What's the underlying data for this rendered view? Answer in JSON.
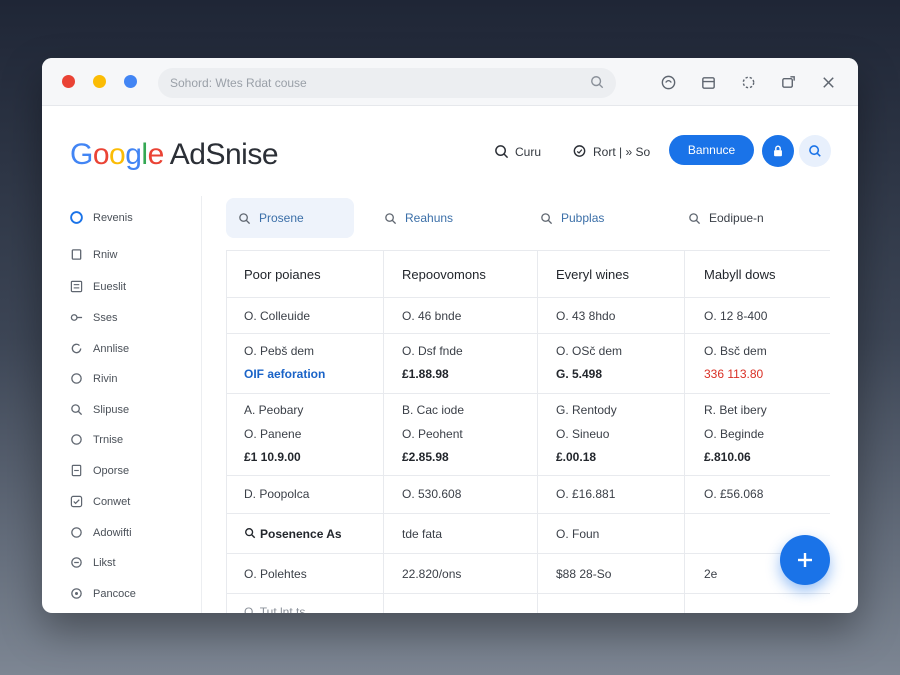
{
  "browser": {
    "url_text": "Sohord: Wtes Rdat couse"
  },
  "header": {
    "logo_google": [
      "G",
      "o",
      "o",
      "g",
      "l",
      "e"
    ],
    "logo_product": "AdSnise",
    "link_one": "Curu",
    "link_two": "Rort | » So",
    "primary_button": "Bannuce"
  },
  "sidebar": {
    "items": [
      {
        "label": "Revenis",
        "icon": "circle-check-icon"
      },
      {
        "label": "Rniw",
        "icon": "square-icon"
      },
      {
        "label": "Eueslit",
        "icon": "list-box-icon"
      },
      {
        "label": "Sses",
        "icon": "key-icon"
      },
      {
        "label": "Annlise",
        "icon": "refresh-icon"
      },
      {
        "label": "Rivin",
        "icon": "circle-icon"
      },
      {
        "label": "Slipuse",
        "icon": "search-icon"
      },
      {
        "label": "Trnise",
        "icon": "circle-icon"
      },
      {
        "label": "Oporse",
        "icon": "doc-icon"
      },
      {
        "label": "Conwet",
        "icon": "check-box-icon"
      },
      {
        "label": "Adowifti",
        "icon": "circle-icon"
      },
      {
        "label": "Likst",
        "icon": "minus-circle-icon"
      },
      {
        "label": "Pancoce",
        "icon": "tag-icon"
      }
    ]
  },
  "tabs": [
    {
      "label": "Prosene"
    },
    {
      "label": "Reahuns"
    },
    {
      "label": "Pubplas"
    },
    {
      "label": "Eodipue-n"
    }
  ],
  "table": {
    "columns": [
      "Poor poianes",
      "Repoovomons",
      "Everyl wines",
      "Mabyll dows"
    ],
    "row1": [
      "O. Colleuide",
      "O. 46 bnde",
      "O. 43 8hdo",
      "O. 12 8-400"
    ],
    "row2a": [
      "O. Pebš dem",
      "O. Dsf fnde",
      "O. OSč dem",
      "O. Bsč dem"
    ],
    "row2b": [
      "OIF aeforation",
      "£1.88.98",
      "G. 5.498",
      "336 113.80"
    ],
    "row3a": [
      "A. Peobary",
      "B. Cac iode",
      "G. Rentody",
      "R. Bet ibery"
    ],
    "row3b": [
      "O. Panene",
      "O. Peohent",
      "O. Sineuo",
      "O. Beginde"
    ],
    "row3c": [
      "£1 10.9.00",
      "£2.85.98",
      "£.00.18",
      "£.810.06"
    ],
    "row4": [
      "D. Poopolca",
      "O. 530.608",
      "O. £16.881",
      "O. £56.068"
    ],
    "row5": [
      "Posenence As",
      "tde fata",
      "O. Foun",
      ""
    ],
    "row6": [
      "O. Polehtes",
      "22.820/ons",
      "$88 28-So",
      "2e"
    ],
    "row7": [
      "O. Tut lnt ts",
      "",
      "",
      ""
    ]
  },
  "colors": {
    "accent": "#1a73e8",
    "highlight_blue": "#1a63c7",
    "highlight_red": "#d93025"
  }
}
